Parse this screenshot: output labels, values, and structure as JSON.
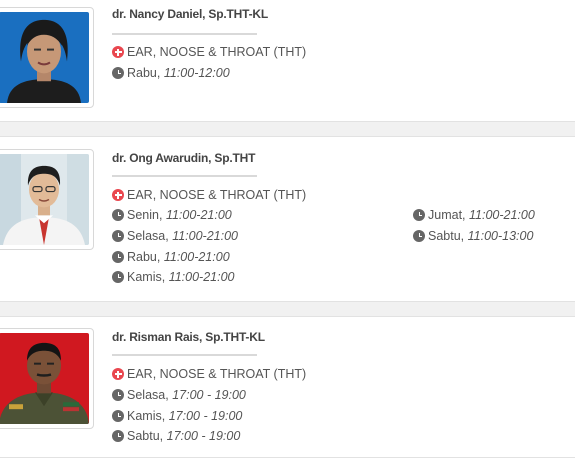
{
  "doctors": [
    {
      "name": "dr. Nancy Daniel, Sp.THT-KL",
      "specialty": "EAR, NOOSE & THROAT (THT)",
      "schedule": [
        {
          "day": "Rabu,",
          "time": "11:00-12:00"
        }
      ]
    },
    {
      "name": "dr. Ong Awarudin, Sp.THT",
      "specialty": "EAR, NOOSE & THROAT (THT)",
      "schedule": [
        {
          "day": "Senin,",
          "time": "11:00-21:00"
        },
        {
          "day": "Selasa,",
          "time": "11:00-21:00"
        },
        {
          "day": "Rabu,",
          "time": "11:00-21:00"
        },
        {
          "day": "Kamis,",
          "time": "11:00-21:00"
        },
        {
          "day": "Jumat,",
          "time": "11:00-21:00"
        },
        {
          "day": "Sabtu,",
          "time": "11:00-13:00"
        }
      ]
    },
    {
      "name": "dr. Risman Rais, Sp.THT-KL",
      "specialty": "EAR, NOOSE & THROAT (THT)",
      "schedule": [
        {
          "day": "Selasa,",
          "time": "17:00 - 19:00"
        },
        {
          "day": "Kamis,",
          "time": "17:00 - 19:00"
        },
        {
          "day": "Sabtu,",
          "time": "17:00 - 19:00"
        }
      ]
    }
  ],
  "colors": {
    "specialty_icon": "#e9474f",
    "clock_icon": "#666666",
    "photo1_bg": "#1a6fc0",
    "photo3_bg": "#d01820"
  }
}
